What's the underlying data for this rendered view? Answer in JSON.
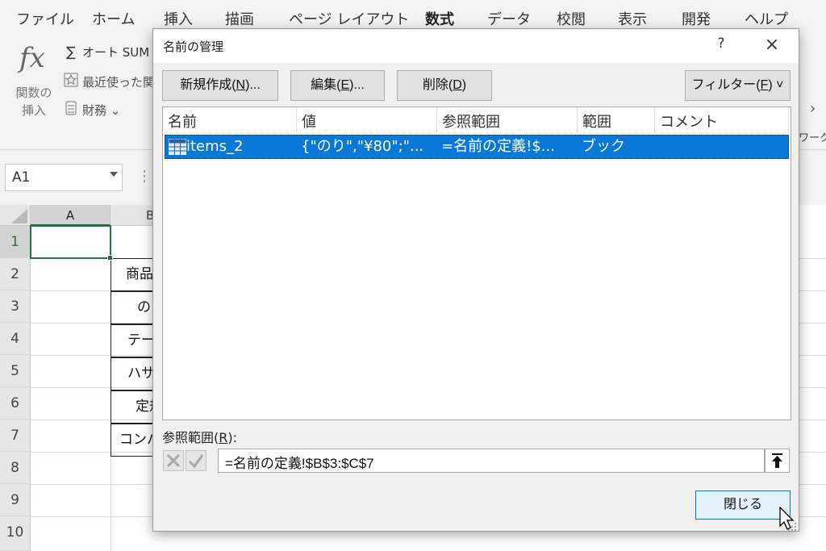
{
  "ribbon": {
    "tabs": [
      "ファイル",
      "ホーム",
      "挿入",
      "描画",
      "ページ レイアウト",
      "数式",
      "データ",
      "校閲",
      "表示",
      "開発",
      "ヘルプ"
    ],
    "active_tab": "数式",
    "function_insert_label_1": "関数の",
    "function_insert_label_2": "挿入",
    "autosum_label": "オート SUM",
    "autosum_icon": "sigma-icon",
    "recent_label": "最近使った関",
    "finance_label": "財務 ⌄",
    "truncated_right_label": "ワーク"
  },
  "formula_bar": {
    "name_box_value": "A1"
  },
  "sheet": {
    "columns": [
      "A",
      "B"
    ],
    "rows": [
      "1",
      "2",
      "3",
      "4",
      "5",
      "6",
      "7",
      "8",
      "9",
      "10"
    ],
    "cells": [
      "商品",
      "のり",
      "テー",
      "ハサ",
      "定規",
      "コンパ"
    ]
  },
  "dialog": {
    "title": "名前の管理",
    "help_label": "?",
    "close_icon": "×",
    "buttons": {
      "new": {
        "pre": "新規作成(",
        "key": "N",
        "post": ")..."
      },
      "edit": {
        "pre": "編集(",
        "key": "E",
        "post": ")..."
      },
      "delete": {
        "pre": "削除(",
        "key": "D",
        "post": ")"
      },
      "filter": {
        "pre": "フィルター(",
        "key": "F",
        "post": ") ˅"
      }
    },
    "list": {
      "columns": [
        "名前",
        "値",
        "参照範囲",
        "範囲",
        "コメント"
      ],
      "rows": [
        {
          "name": "items_2",
          "value": "{\"のり\",\"¥80\";\"...",
          "refers_to": "=名前の定義!$...",
          "scope": "ブック",
          "comment": ""
        }
      ]
    },
    "refers_label": {
      "pre": "参照範囲(",
      "key": "R",
      "post": "):"
    },
    "refers_value": "=名前の定義!$B$3:$C$7",
    "close_button": "閉じる"
  },
  "colors": {
    "accent_green": "#217346",
    "selection_blue": "#0a78d7",
    "close_button_border": "#0078d7"
  }
}
